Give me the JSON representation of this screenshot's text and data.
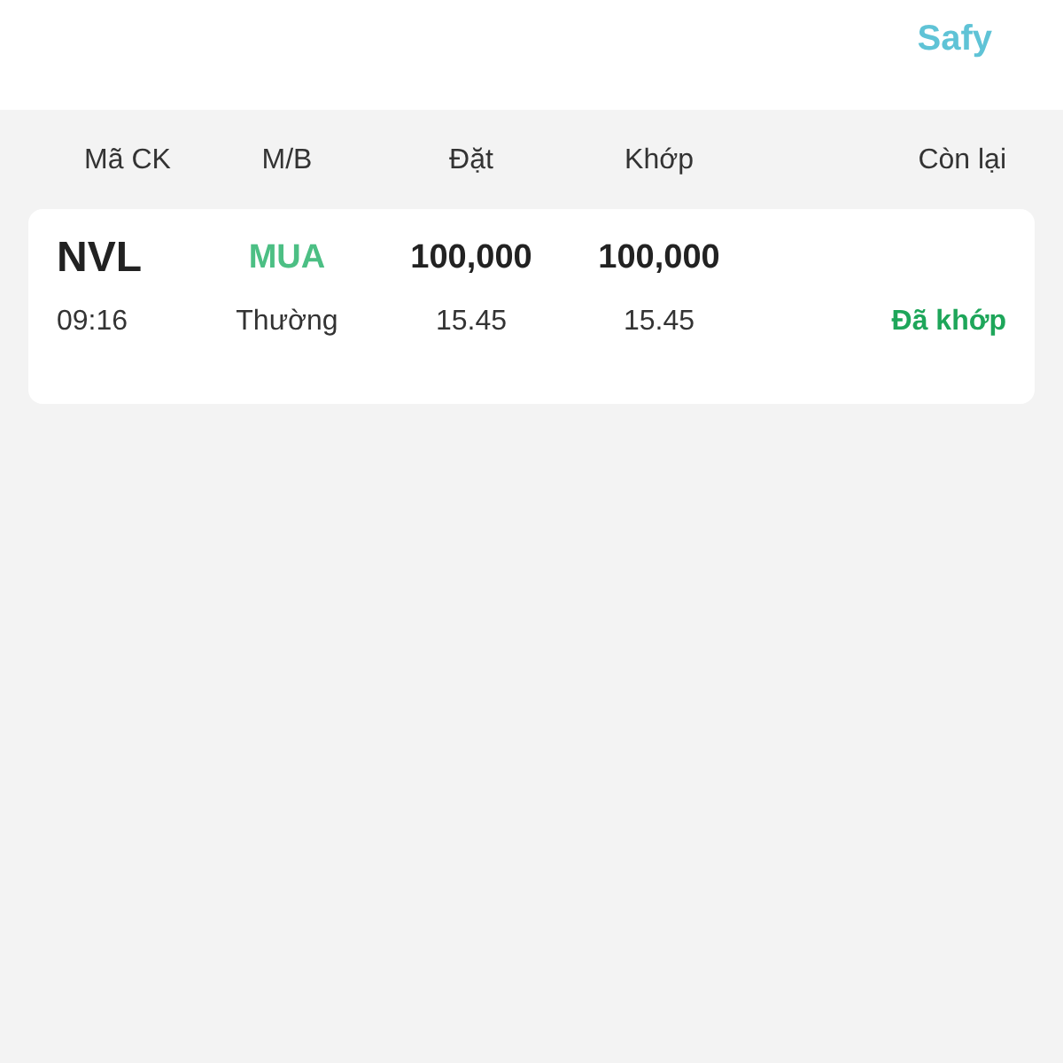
{
  "header": {
    "brand": "Safy"
  },
  "columns": [
    "Mã CK",
    "M/B",
    "Đặt",
    "Khớp",
    "Còn lại"
  ],
  "orders": [
    {
      "symbol": "NVL",
      "side": {
        "text": "MUA",
        "color": "#4cbf84"
      },
      "ordered_qty": "100,000",
      "matched_qty": "100,000",
      "time": "09:16",
      "order_type": "Thường",
      "ordered_price": "15.45",
      "matched_price": "15.45",
      "status": {
        "text": "Đã khớp",
        "color": "#1ea65a"
      }
    }
  ]
}
